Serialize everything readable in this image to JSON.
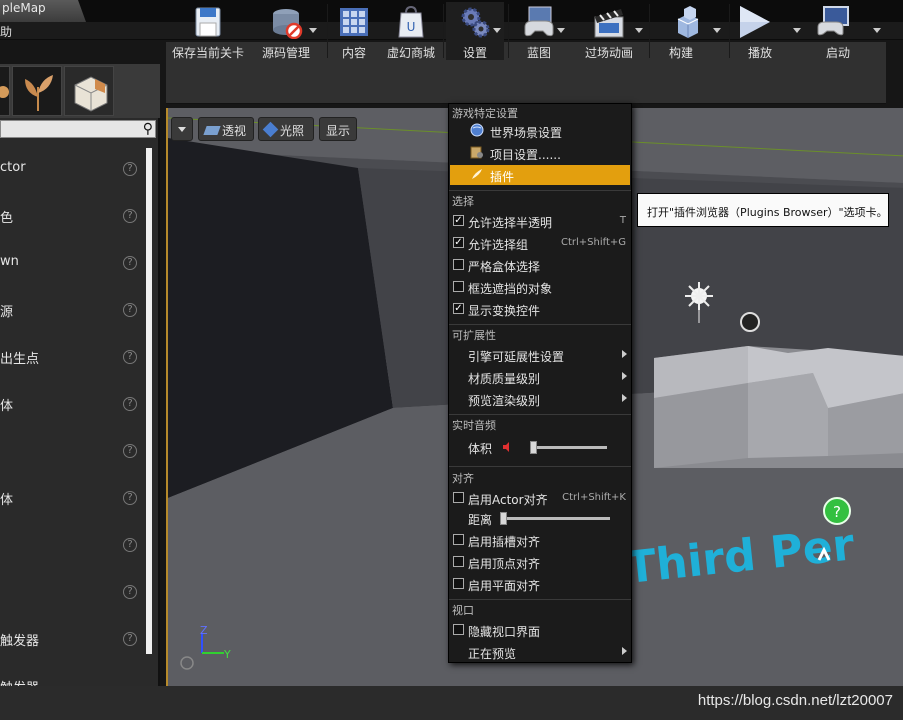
{
  "window": {
    "tab_title": "pleMap",
    "menu_item": "助"
  },
  "left_panel": {
    "rows": [
      {
        "label": "ctor"
      },
      {
        "label": "色"
      },
      {
        "label": "wn"
      },
      {
        "label": "源"
      },
      {
        "label": "出生点"
      },
      {
        "label": "体"
      },
      {
        "label": ""
      },
      {
        "label": "体"
      },
      {
        "label": ""
      },
      {
        "label": ""
      },
      {
        "label": "触发器"
      },
      {
        "label": "触发器"
      }
    ]
  },
  "toolbar": {
    "buttons": [
      {
        "label": "保存当前关卡",
        "icon": "floppy-disk-icon"
      },
      {
        "label": "源码管理",
        "icon": "source-control-icon"
      },
      {
        "label": "内容",
        "icon": "content-grid-icon"
      },
      {
        "label": "虚幻商城",
        "icon": "marketplace-bag-icon"
      },
      {
        "label": "设置",
        "icon": "settings-gears-icon"
      },
      {
        "label": "蓝图",
        "icon": "blueprint-gamepad-icon"
      },
      {
        "label": "过场动画",
        "icon": "clapperboard-icon"
      },
      {
        "label": "构建",
        "icon": "build-cubes-icon"
      },
      {
        "label": "播放",
        "icon": "play-icon"
      },
      {
        "label": "启动",
        "icon": "launch-monitor-icon"
      }
    ]
  },
  "viewport": {
    "buttons": {
      "perspective": "透视",
      "lit": "光照",
      "show": "显示"
    },
    "floor_text": "Third Per",
    "axes": {
      "z": "Z",
      "y": "Y"
    }
  },
  "dropdown": {
    "sections": {
      "game": "游戏特定设置",
      "selection": "选择",
      "scalability": "可扩展性",
      "audio": "实时音频",
      "snap": "对齐",
      "viewport": "视口"
    },
    "items": {
      "world_settings": "世界场景设置",
      "project_settings": "项目设置......",
      "plugins": "插件",
      "allow_translucent": "允许选择半透明",
      "allow_translucent_key": "T",
      "allow_group": "允许选择组",
      "allow_group_key": "Ctrl+Shift+G",
      "strict_box": "严格盒体选择",
      "box_occluded": "框选遮挡的对象",
      "show_transform": "显示变换控件",
      "engine_scalability": "引擎可延展性设置",
      "material_quality": "材质质量级别",
      "preview_rendering": "预览渲染级别",
      "volume": "体积",
      "actor_snap": "启用Actor对齐",
      "actor_snap_key": "Ctrl+Shift+K",
      "distance": "距离",
      "socket_snap": "启用插槽对齐",
      "vertex_snap": "启用顶点对齐",
      "plane_snap": "启用平面对齐",
      "hide_viewport_ui": "隐藏视口界面",
      "previewing": "正在预览"
    },
    "checked": {
      "allow_translucent": true,
      "allow_group": true,
      "strict_box": false,
      "box_occluded": false,
      "show_transform": true,
      "actor_snap": false,
      "socket_snap": false,
      "vertex_snap": false,
      "plane_snap": false,
      "hide_viewport_ui": false
    },
    "volume_level": 0.0,
    "distance_level": 0.0,
    "highlight_color": "#e39f0e"
  },
  "tooltip": {
    "text": "打开\"插件浏览器（Plugins Browser）\"选项卡。"
  },
  "watermark": "https://blog.csdn.net/lzt20007"
}
